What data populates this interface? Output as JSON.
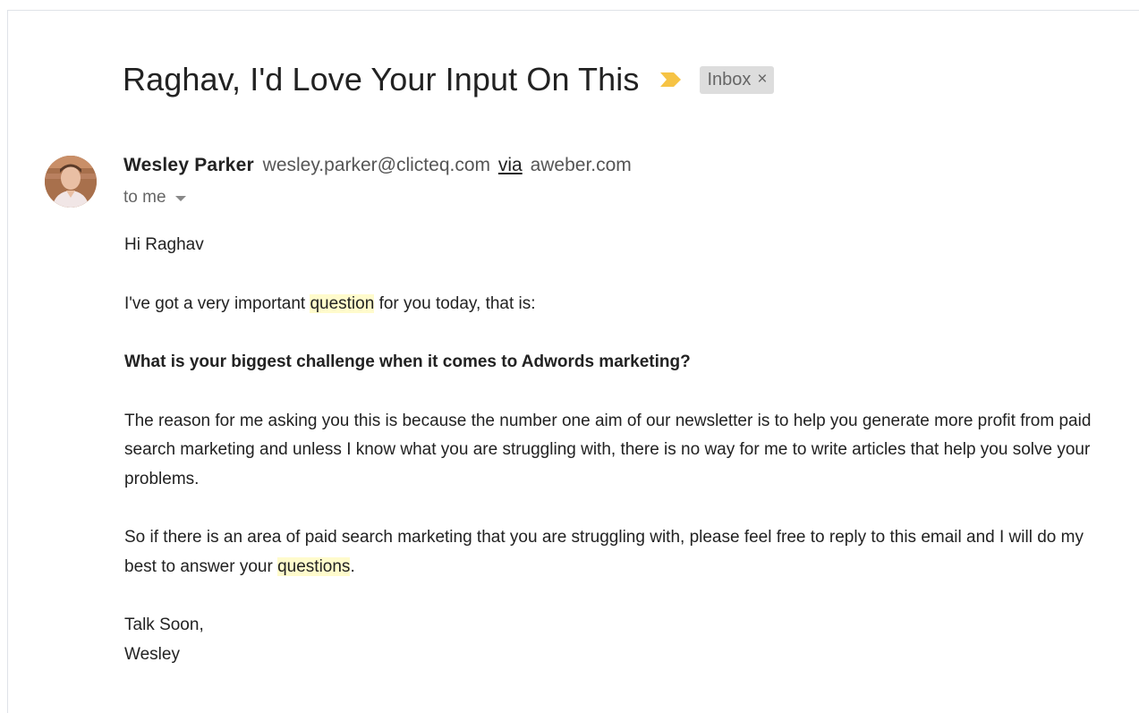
{
  "email": {
    "subject": "Raghav, I'd Love Your Input On This",
    "label_chip": {
      "text": "Inbox",
      "close_glyph": "×"
    },
    "importance_icon": "importance-marker-icon",
    "importance_color": "#f6c344",
    "sender": {
      "name": "Wesley Parker",
      "email": "wesley.parker@clicteq.com",
      "via_label": "via",
      "via_domain": "aweber.com"
    },
    "recipient_label": "to me",
    "body": {
      "greeting": "Hi Raghav",
      "p1_before": "I've got a very important ",
      "p1_highlight": "question",
      "p1_after": " for you today, that is:",
      "question": "What is your biggest challenge when it comes to Adwords marketing?",
      "p3": "The reason for me asking you this is because the number one aim of our newsletter is to help you generate more profit from paid search marketing and unless I know what you are struggling with, there is no way for me to write articles that help you solve your problems.",
      "p4_before": "So if there is an area of paid search marketing that you are struggling with, please feel free to reply to this email and I will do my best to answer your ",
      "p4_highlight": "questions",
      "p4_after": ".",
      "signoff": "Talk Soon,",
      "signature": "Wesley"
    },
    "highlight_color": "#fffbcc"
  }
}
